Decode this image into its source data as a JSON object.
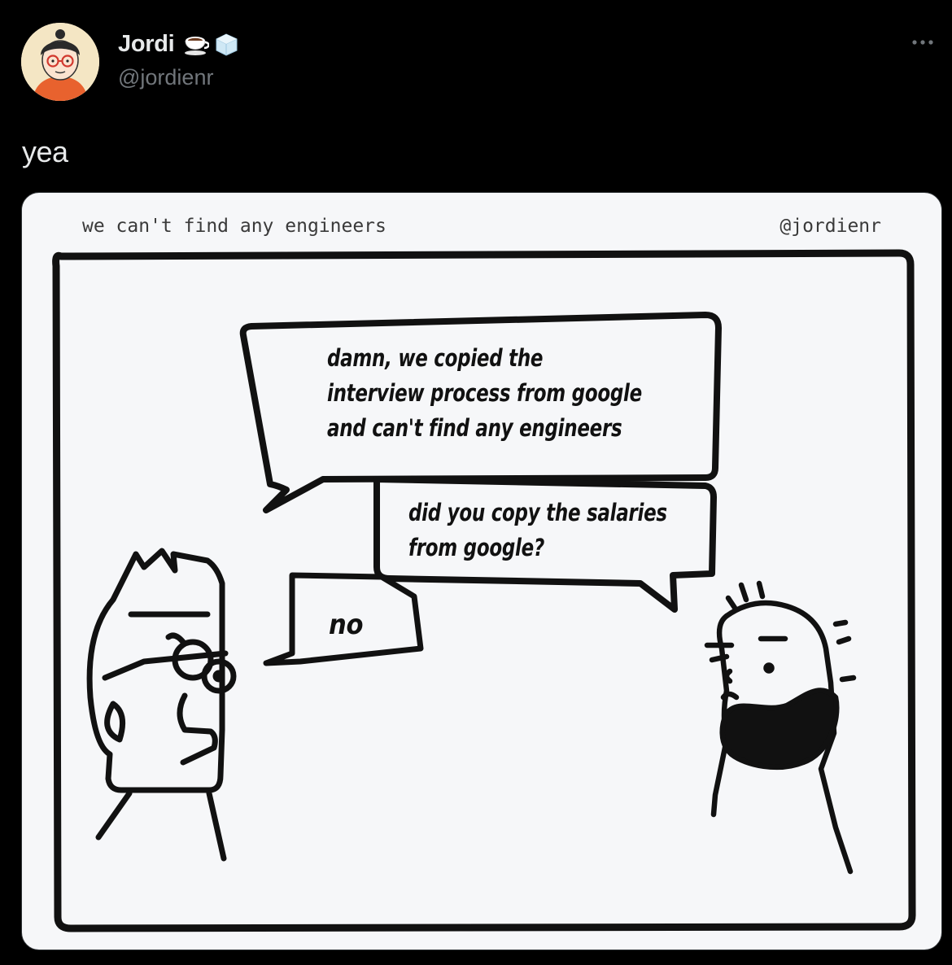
{
  "author": {
    "display_name": "Jordi",
    "handle": "@jordienr",
    "name_emojis": [
      "coffee-cup-emoji",
      "ice-cube-emoji"
    ]
  },
  "tweet": {
    "text": "yea",
    "more_icon": "more-horizontal-icon"
  },
  "comic": {
    "title": "we can't find any engineers",
    "credit": "@jordienr",
    "bubbles": [
      {
        "speaker": "left-character",
        "text": "damn, we copied the\ninterview process from google\nand can't find any engineers"
      },
      {
        "speaker": "right-character",
        "text": "did you copy the salaries\nfrom google?"
      },
      {
        "speaker": "left-character",
        "text": "no"
      }
    ]
  },
  "colors": {
    "background": "#000000",
    "text_primary": "#e7e9ea",
    "text_secondary": "#71767b",
    "comic_paper": "#f6f7f9",
    "ink": "#111111"
  }
}
